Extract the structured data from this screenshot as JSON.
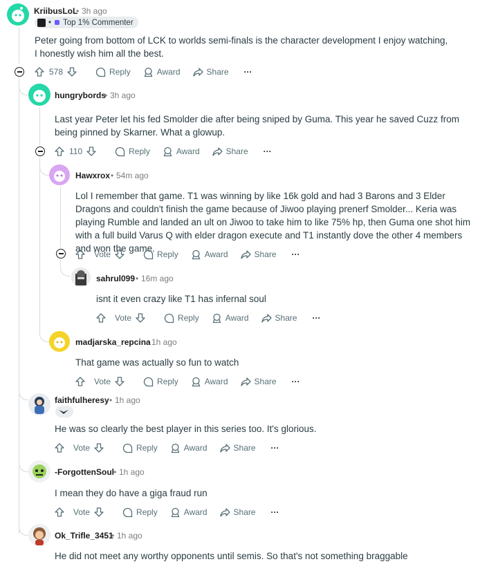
{
  "comments": [
    {
      "username": "KriibusLoL",
      "time": "3h ago",
      "badge": "Top 1% Commenter",
      "body": "Peter going from bottom of LCK to worlds semi-finals is the character development I enjoy watching, I honestly wish him all the best.",
      "votes": "578",
      "reply": "Reply",
      "award": "Award",
      "share": "Share",
      "more": "···"
    },
    {
      "username": "hungrybords",
      "time": "3h ago",
      "body": "Last year Peter let his fed Smolder die after being sniped by Guma. This year he saved Cuzz from being pinned by Skarner. What a glowup.",
      "votes": "110",
      "reply": "Reply",
      "award": "Award",
      "share": "Share",
      "more": "···"
    },
    {
      "username": "Hawxrox",
      "time": "54m ago",
      "body": "Lol I remember that game. T1 was winning by like 16k gold and had 3 Barons and 3 Elder Dragons and couldn't finish the game because of Jiwoo playing prenerf Smolder... Keria was playing Rumble and landed an ult on Jiwoo to take him to like 75% hp, then Guma one shot him with a full build Varus Q with elder dragon execute and T1 instantly dove the other 4 members and won the game.",
      "votes": "Vote",
      "reply": "Reply",
      "award": "Award",
      "share": "Share",
      "more": "···"
    },
    {
      "username": "sahrul099",
      "time": "16m ago",
      "body": "isnt it even crazy like T1 has infernal soul",
      "votes": "Vote",
      "reply": "Reply",
      "award": "Award",
      "share": "Share",
      "more": "···"
    },
    {
      "username": "madjarska_repcina",
      "time": "1h ago",
      "body": "That game was actually so fun to watch",
      "votes": "Vote",
      "reply": "Reply",
      "award": "Award",
      "share": "Share",
      "more": "···"
    },
    {
      "username": "faithfulheresy",
      "time": "1h ago",
      "body": "He was so clearly the best player in this series too. It's glorious.",
      "votes": "Vote",
      "reply": "Reply",
      "award": "Award",
      "share": "Share",
      "more": "···"
    },
    {
      "username": "-ForgottenSoul",
      "time": "1h ago",
      "body": "I mean they do have a giga fraud run",
      "votes": "Vote",
      "reply": "Reply",
      "award": "Award",
      "share": "Share",
      "more": "···"
    },
    {
      "username": "Ok_Trifle_3451",
      "time": "1h ago",
      "body": "He did not meet any worthy opponents until semis. So that's not something braggable"
    }
  ],
  "separator": "•",
  "colors": {
    "text": "#1c1c1c",
    "muted": "#576f76",
    "thread_line": "#d7dadc",
    "badge_bg": "#eaedef"
  }
}
